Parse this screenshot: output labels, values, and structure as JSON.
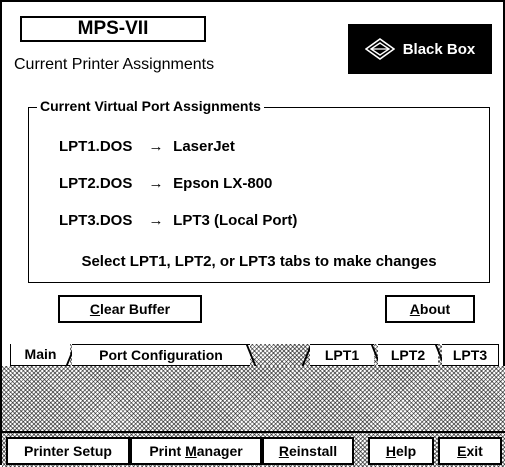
{
  "header": {
    "title": "MPS-VII",
    "subtitle": "Current Printer Assignments",
    "brand": "Black Box"
  },
  "assignments": {
    "group_title": "Current Virtual Port Assignments",
    "rows": [
      {
        "port": "LPT1.DOS",
        "arrow": "→",
        "printer": "LaserJet"
      },
      {
        "port": "LPT2.DOS",
        "arrow": "→",
        "printer": "Epson LX-800"
      },
      {
        "port": "LPT3.DOS",
        "arrow": "→",
        "printer": "LPT3 (Local Port)"
      }
    ],
    "hint": "Select LPT1, LPT2, or LPT3 tabs to make changes"
  },
  "buttons": {
    "clear_buffer": {
      "accel": "C",
      "rest": "lear Buffer"
    },
    "about": {
      "accel": "A",
      "rest": "bout"
    }
  },
  "tabs": {
    "main": "Main",
    "port_configuration": "Port Configuration",
    "lpt1": "LPT1",
    "lpt2": "LPT2",
    "lpt3": "LPT3",
    "selected": "Main"
  },
  "toolbar": {
    "printer_setup": "Printer Setup",
    "print_manager": {
      "before": "Print ",
      "accel": "M",
      "after": "anager"
    },
    "reinstall": {
      "accel": "R",
      "rest": "einstall"
    },
    "help": {
      "accel": "H",
      "rest": "elp"
    },
    "exit": {
      "accel": "E",
      "rest": "xit"
    }
  },
  "colors": {
    "foreground": "#000000",
    "background": "#ffffff",
    "logo_background": "#000000"
  }
}
